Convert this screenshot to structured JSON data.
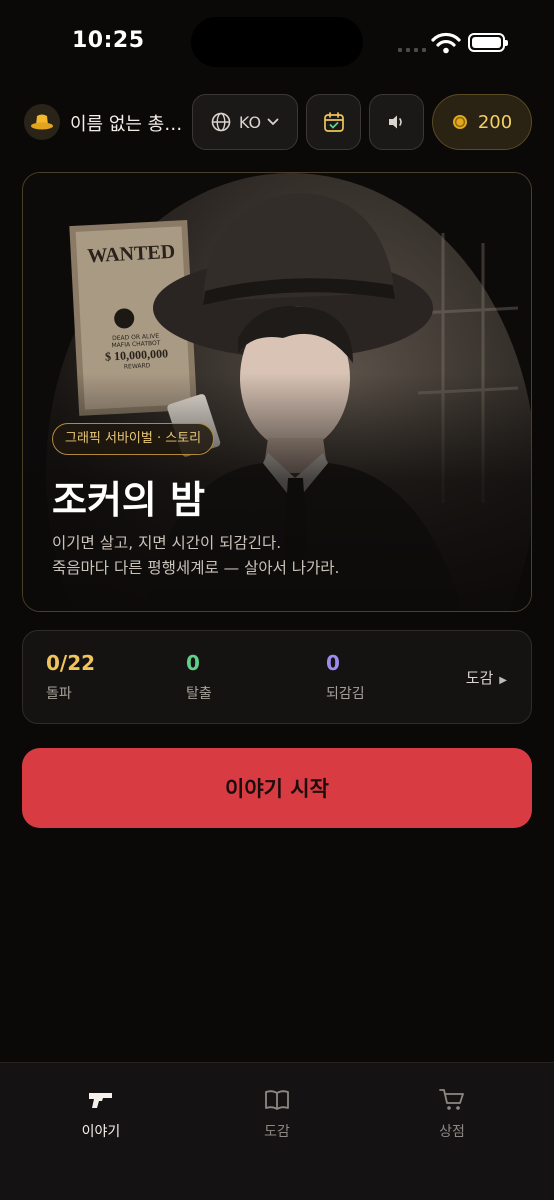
{
  "status": {
    "time": "10:25"
  },
  "header": {
    "profile_name": "이름 없는 총…",
    "language": "KO",
    "coins": "200"
  },
  "hero": {
    "genre": "그래픽 서바이벌 · 스토리",
    "title": "조커의 밤",
    "desc_line1": "이기면 살고, 지면 시간이 되감긴다.",
    "desc_line2": "죽음마다 다른 평행세계로 — 살아서 나가라.",
    "poster": {
      "wanted": "WANTED",
      "line1": "DEAD OR ALIVE",
      "line2": "MAFIA CHATBOT",
      "reward": "$ 10,000,000",
      "line3": "REWARD"
    }
  },
  "stats": {
    "breakthrough": {
      "value": "0/22",
      "label": "돌파"
    },
    "escape": {
      "value": "0",
      "label": "탈출"
    },
    "rewind": {
      "value": "0",
      "label": "되감김"
    },
    "dex_link": "도감"
  },
  "cta": {
    "label": "이야기 시작"
  },
  "nav": {
    "items": [
      {
        "label": "이야기",
        "icon": "gun-icon"
      },
      {
        "label": "도감",
        "icon": "book-icon"
      },
      {
        "label": "상점",
        "icon": "cart-icon"
      }
    ]
  },
  "colors": {
    "accent_red": "#d83b42",
    "gold": "#f1c45b",
    "green": "#5fcf8b",
    "purple": "#9c8cf0"
  }
}
